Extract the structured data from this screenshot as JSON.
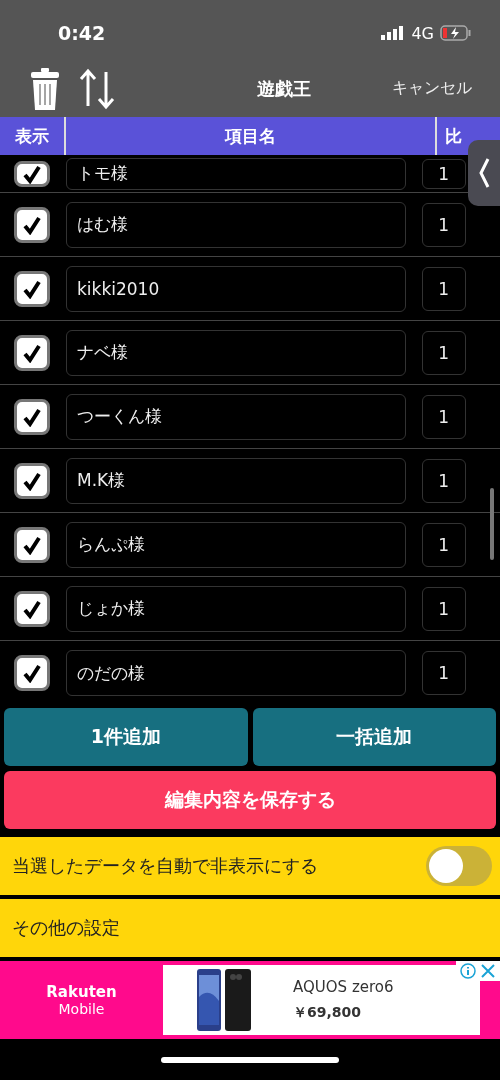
{
  "status_bar": {
    "time": "0:42",
    "network": "4G"
  },
  "nav": {
    "title": "遊戯王",
    "cancel": "キャンセル"
  },
  "table": {
    "columns": [
      "表示",
      "項目名",
      "比"
    ],
    "rows": [
      {
        "checked": true,
        "name": "トモ様",
        "ratio": "1"
      },
      {
        "checked": true,
        "name": "はむ様",
        "ratio": "1"
      },
      {
        "checked": true,
        "name": "kikki2010",
        "ratio": "1"
      },
      {
        "checked": true,
        "name": "ナベ様",
        "ratio": "1"
      },
      {
        "checked": true,
        "name": "つーくん様",
        "ratio": "1"
      },
      {
        "checked": true,
        "name": "M.K様",
        "ratio": "1"
      },
      {
        "checked": true,
        "name": "らんぷ様",
        "ratio": "1"
      },
      {
        "checked": true,
        "name": "じょか様",
        "ratio": "1"
      },
      {
        "checked": true,
        "name": "のだの様",
        "ratio": "1"
      }
    ]
  },
  "buttons": {
    "add_one": "1件追加",
    "add_bulk": "一括追加",
    "save": "編集内容を保存する"
  },
  "settings": [
    {
      "kind": "toggle",
      "label": "当選したデータを自動で非表示にする",
      "on": false
    },
    {
      "kind": "link",
      "label": "その他の設定"
    }
  ],
  "ad": {
    "brand_line_1": "Rakuten",
    "brand_line_2": "Mobile",
    "product": "AQUOS zero6",
    "price": "￥69,800"
  }
}
